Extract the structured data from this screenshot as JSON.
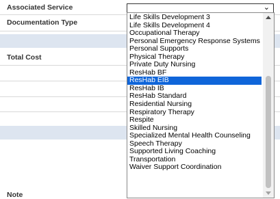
{
  "form": {
    "associated_service_label": "Associated Service",
    "documentation_type_label": "Documentation Type",
    "total_cost_label": "Total Cost",
    "note_label": "Note"
  },
  "dropdown": {
    "icon": "chevron-down-icon",
    "selected": "ResHab EIB",
    "options": [
      "Life Skills Development 3",
      "Life Skills Development 4",
      "Occupational Therapy",
      "Personal Emergency Response Systems",
      "Personal Supports",
      "Physical Therapy",
      "Private Duty Nursing",
      "ResHab BF",
      "ResHab EIB",
      "ResHab IB",
      "ResHab Standard",
      "Residential Nursing",
      "Respiratory Therapy",
      "Respite",
      "Skilled Nursing",
      "Specialized Mental Health Counseling",
      "Speech Therapy",
      "Supported Living Coaching",
      "Transportation",
      "Waiver Support Coordination"
    ]
  },
  "colors": {
    "selection": "#0f65d9",
    "section_band": "#dde5f0"
  }
}
